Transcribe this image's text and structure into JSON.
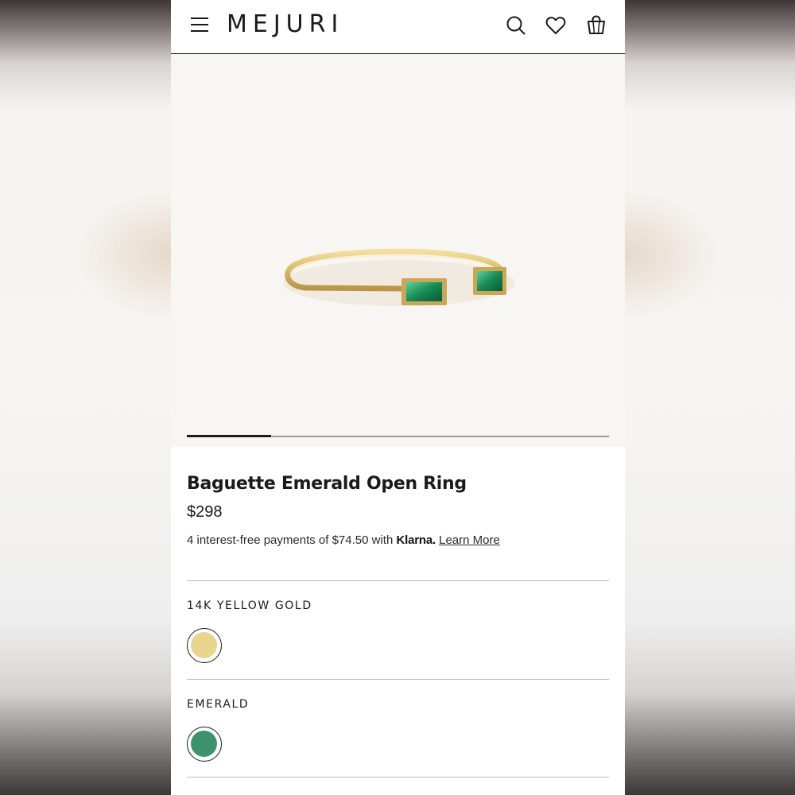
{
  "header": {
    "brand": "MEJURI",
    "icons": [
      "menu-icon",
      "search-icon",
      "heart-icon",
      "bag-icon"
    ]
  },
  "gallery": {
    "image_alt": "Baguette Emerald Open Ring",
    "slide_index": 1,
    "slide_count": 5
  },
  "product": {
    "title": "Baguette Emerald Open Ring",
    "price": "$298",
    "klarna": {
      "prefix": "4 interest-free payments of $74.50 with ",
      "brand": "Klarna.",
      "link": "Learn More"
    }
  },
  "options": [
    {
      "label": "14K YELLOW GOLD",
      "swatch_color": "#e8d690",
      "selected": true
    },
    {
      "label": "EMERALD",
      "swatch_color": "#3c936b",
      "selected": true
    }
  ],
  "colors": {
    "gallery_bg": "#f8f6f2",
    "text": "#1a1a1a",
    "gold": "#e8d690",
    "emerald": "#3c936b"
  }
}
